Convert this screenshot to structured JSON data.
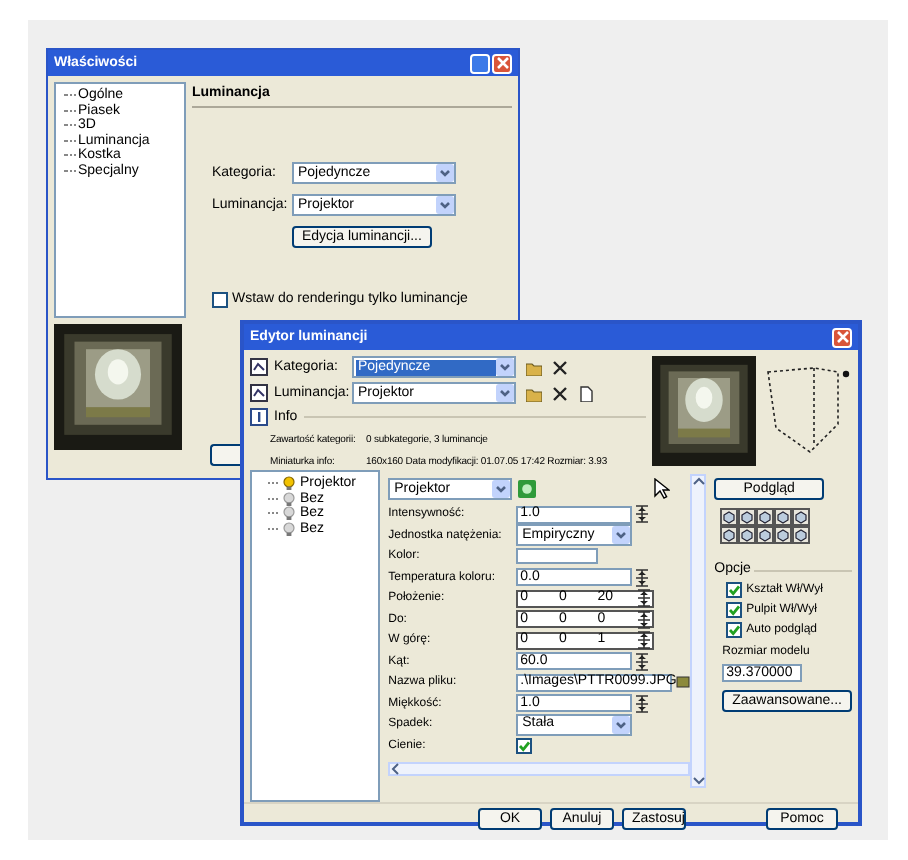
{
  "back_dialog": {
    "title": "Właściwości",
    "tree_items": [
      "Ogólne",
      "Piasek",
      "3D",
      "Luminancja",
      "Kostka",
      "Specjalny"
    ],
    "section_title": "Luminancja",
    "fields": [
      {
        "label": "Kategoria:",
        "value": "Pojedyncze"
      },
      {
        "label": "Luminancja:",
        "value": "Projektor"
      }
    ],
    "edit_button": "Edycja luminancji...",
    "checkbox": {
      "label": "Wstaw do renderingu tylko luminancje",
      "checked": false
    }
  },
  "front_dialog": {
    "title": "Edytor luminancji",
    "fields": [
      {
        "label": "Kategoria:",
        "value": "Pojedyncze",
        "highlighted": true
      },
      {
        "label": "Luminancja:",
        "value": "Projektor",
        "highlighted": false
      }
    ],
    "info_label": "Info",
    "info_rows": [
      {
        "label": "Zawartość kategorii:",
        "value": "0 subkategorie, 3 luminancje"
      },
      {
        "label": "Miniaturka info:",
        "value": "160x160  Data modyfikacji: 01.07.05 17:42 Rozmiar: 3.93"
      }
    ],
    "tree": [
      {
        "label": "Projektor",
        "on": true
      },
      {
        "label": "Bez",
        "on": false
      },
      {
        "label": "Bez",
        "on": false
      },
      {
        "label": "Bez",
        "on": false
      }
    ],
    "type_dropdown": "Projektor",
    "properties": [
      {
        "kind": "number",
        "label": "Intensywność:",
        "value": "1.0"
      },
      {
        "kind": "dropdown",
        "label": "Jednostka natężenia:",
        "value": "Empiryczny"
      },
      {
        "kind": "color",
        "label": "Kolor:"
      },
      {
        "kind": "number",
        "label": "Temperatura koloru:",
        "value": "0.0"
      },
      {
        "kind": "triple",
        "label": "Położenie:",
        "values": [
          "0",
          "0",
          "20"
        ]
      },
      {
        "kind": "triple",
        "label": "Do:",
        "values": [
          "0",
          "0",
          "0"
        ]
      },
      {
        "kind": "triple",
        "label": "W górę:",
        "values": [
          "0",
          "0",
          "1"
        ]
      },
      {
        "kind": "number",
        "label": "Kąt:",
        "value": "60.0"
      },
      {
        "kind": "file",
        "label": "Nazwa pliku:",
        "value": ".\\Images\\PTTR0099.JPG"
      },
      {
        "kind": "number",
        "label": "Miękkość:",
        "value": "1.0"
      },
      {
        "kind": "dropdown",
        "label": "Spadek:",
        "value": "Stała"
      },
      {
        "kind": "checkbox",
        "label": "Cienie:",
        "checked": true
      }
    ],
    "preview_button": "Podgląd",
    "options_title": "Opcje",
    "options": [
      {
        "label": "Kształt Wł/Wył",
        "checked": true
      },
      {
        "label": "Pulpit Wł/Wył",
        "checked": true
      },
      {
        "label": "Auto podgląd",
        "checked": true
      }
    ],
    "model_size_label": "Rozmiar modelu",
    "model_size_value": "39.370000",
    "advanced_button": "Zaawansowane...",
    "buttons": [
      "OK",
      "Anuluj",
      "Zastosuj",
      "Pomoc"
    ]
  }
}
